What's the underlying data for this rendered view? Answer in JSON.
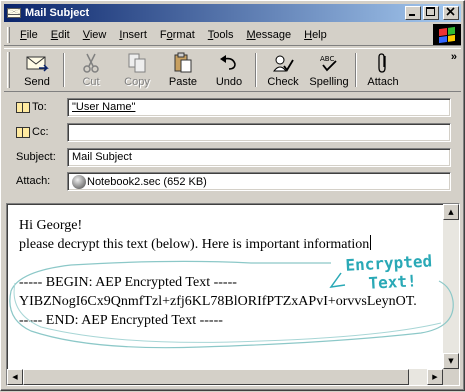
{
  "window": {
    "title": "Mail Subject"
  },
  "menu": [
    {
      "label": "File",
      "key": "F"
    },
    {
      "label": "Edit",
      "key": "E"
    },
    {
      "label": "View",
      "key": "V"
    },
    {
      "label": "Insert",
      "key": "I"
    },
    {
      "label": "Format",
      "key": "o"
    },
    {
      "label": "Tools",
      "key": "T"
    },
    {
      "label": "Message",
      "key": "M"
    },
    {
      "label": "Help",
      "key": "H"
    }
  ],
  "toolbar": {
    "send": "Send",
    "cut": "Cut",
    "copy": "Copy",
    "paste": "Paste",
    "undo": "Undo",
    "check": "Check",
    "spelling": "Spelling",
    "attach": "Attach",
    "more": "»"
  },
  "header": {
    "to_label": "To:",
    "to_value": "\"User Name\"",
    "cc_label": "Cc:",
    "cc_value": "",
    "subject_label": "Subject:",
    "subject_value": "Mail Subject",
    "attach_label": "Attach:",
    "attach_value": "Notebook2.sec (652 KB)"
  },
  "body": {
    "line1": "Hi George!",
    "line2": "please decrypt this text (below). Here is important information",
    "line3": "----- BEGIN: AEP Encrypted Text -----",
    "line4": "YIBZNogI6Cx9QnmfTzl+zfj6KL78BlORIfPTZxAPvI+orvvsLeynOT.",
    "line5": "----- END: AEP Encrypted Text -----"
  },
  "annotation": {
    "line1": "Encrypted",
    "line2": "Text!",
    "color": "#2aa9b6"
  },
  "colors": {
    "titlebar_start": "#0a246a",
    "titlebar_end": "#a6caf0",
    "chrome": "#d4d0c8"
  }
}
